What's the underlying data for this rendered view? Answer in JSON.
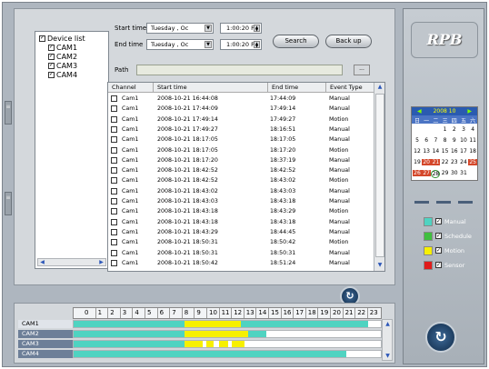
{
  "device_tree": {
    "root": "Device list",
    "items": [
      "CAM1",
      "CAM2",
      "CAM3",
      "CAM4"
    ]
  },
  "search": {
    "start_label": "Start time",
    "end_label": "End time",
    "path_label": "Path",
    "start_date": "Tuesday , Oc",
    "start_time": "1:00:20 PM",
    "end_date": "Tuesday , Oc",
    "end_time": "1:00:20 PM",
    "search_button": "Search",
    "backup_button": "Back up",
    "browse_button": "...",
    "path_value": ""
  },
  "table": {
    "columns": [
      "Channel",
      "Start time",
      "End time",
      "Event Type"
    ],
    "rows": [
      [
        "Cam1",
        "2008-10-21 16:44:08",
        "17:44:09",
        "Manual"
      ],
      [
        "Cam1",
        "2008-10-21 17:44:09",
        "17:49:14",
        "Manual"
      ],
      [
        "Cam1",
        "2008-10-21 17:49:14",
        "17:49:27",
        "Motion"
      ],
      [
        "Cam1",
        "2008-10-21 17:49:27",
        "18:16:51",
        "Manual"
      ],
      [
        "Cam1",
        "2008-10-21 18:17:05",
        "18:17:05",
        "Manual"
      ],
      [
        "Cam1",
        "2008-10-21 18:17:05",
        "18:17:20",
        "Motion"
      ],
      [
        "Cam1",
        "2008-10-21 18:17:20",
        "18:37:19",
        "Manual"
      ],
      [
        "Cam1",
        "2008-10-21 18:42:52",
        "18:42:52",
        "Manual"
      ],
      [
        "Cam1",
        "2008-10-21 18:42:52",
        "18:43:02",
        "Motion"
      ],
      [
        "Cam1",
        "2008-10-21 18:43:02",
        "18:43:03",
        "Manual"
      ],
      [
        "Cam1",
        "2008-10-21 18:43:03",
        "18:43:18",
        "Manual"
      ],
      [
        "Cam1",
        "2008-10-21 18:43:18",
        "18:43:29",
        "Motion"
      ],
      [
        "Cam1",
        "2008-10-21 18:43:18",
        "18:43:18",
        "Manual"
      ],
      [
        "Cam1",
        "2008-10-21 18:43:29",
        "18:44:45",
        "Manual"
      ],
      [
        "Cam1",
        "2008-10-21 18:50:31",
        "18:50:42",
        "Motion"
      ],
      [
        "Cam1",
        "2008-10-21 18:50:31",
        "18:50:31",
        "Manual"
      ],
      [
        "Cam1",
        "2008-10-21 18:50:42",
        "18:51:24",
        "Manual"
      ]
    ]
  },
  "timeline": {
    "hours": [
      "0",
      "1",
      "2",
      "3",
      "4",
      "5",
      "6",
      "7",
      "8",
      "9",
      "10",
      "11",
      "12",
      "13",
      "14",
      "15",
      "16",
      "17",
      "18",
      "19",
      "20",
      "21",
      "22",
      "23"
    ],
    "cameras": [
      "CAM1",
      "CAM2",
      "CAM3",
      "CAM4"
    ]
  },
  "right_panel": {
    "logo": "RPB",
    "calendar": {
      "header": "2008  10",
      "weekdays": [
        "日",
        "一",
        "二",
        "三",
        "四",
        "五",
        "六"
      ],
      "rows": [
        [
          "",
          "",
          "",
          "1",
          "2",
          "3",
          "4"
        ],
        [
          "5",
          "6",
          "7",
          "8",
          "9",
          "10",
          "11"
        ],
        [
          "12",
          "13",
          "14",
          "15",
          "16",
          "17",
          "18"
        ],
        [
          "19",
          "20",
          "21",
          "22",
          "23",
          "24",
          "25"
        ],
        [
          "26",
          "27",
          "28",
          "29",
          "30",
          "31",
          ""
        ]
      ],
      "highlighted_days": [
        "20",
        "21",
        "25",
        "26",
        "27"
      ],
      "selected_day": "28"
    },
    "legend": [
      {
        "label": "Manual",
        "color": "#4fd3c1"
      },
      {
        "label": "Schedule",
        "color": "#3fbf3f"
      },
      {
        "label": "Motion",
        "color": "#f7f000"
      },
      {
        "label": "Sensor",
        "color": "#e01b1b"
      }
    ]
  },
  "colors": {
    "manual": "#4fd3c1",
    "motion": "#f7f000",
    "timeline_cam_bg": "#6d7f98"
  }
}
